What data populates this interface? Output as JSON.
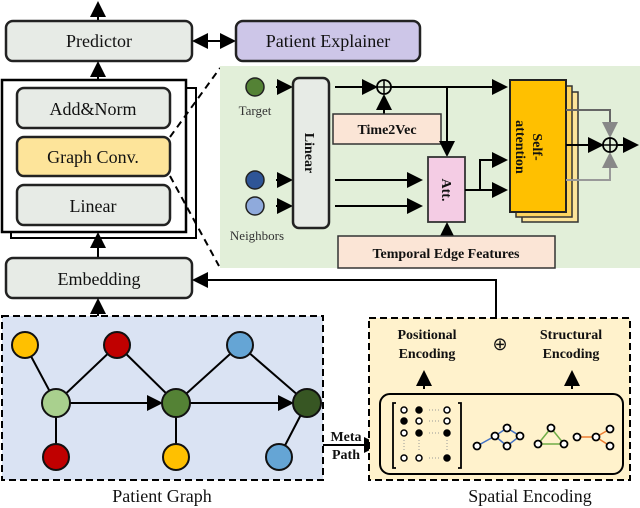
{
  "left_stack": {
    "predictor": "Predictor",
    "explainer": "Patient Explainer",
    "add_norm": "Add&Norm",
    "graph_conv": "Graph Conv.",
    "linear": "Linear",
    "embedding": "Embedding"
  },
  "graph_conv_detail": {
    "target": "Target",
    "neighbors": "Neighbors",
    "linear": "Linear",
    "time2vec": "Time2Vec",
    "att": "Att.",
    "temporal_edge": "Temporal Edge Features",
    "self_attention_1": "Self-",
    "self_attention_2": "attention"
  },
  "patient_graph": {
    "label": "Patient Graph"
  },
  "meta_path": {
    "line1": "Meta",
    "line2": "Path"
  },
  "spatial": {
    "label": "Spatial Encoding",
    "pos1": "Positional",
    "pos2": "Encoding",
    "struct1": "Structural",
    "struct2": "Encoding",
    "plus": "⊕"
  },
  "colors": {
    "graph_conv": "#fde49a",
    "explainer": "#cdc6e8",
    "green_panel": "#e2efd9",
    "patient_graph_bg": "#dae3f3",
    "spatial_bg": "#fff2cc",
    "self_attention": "#ffc000"
  }
}
